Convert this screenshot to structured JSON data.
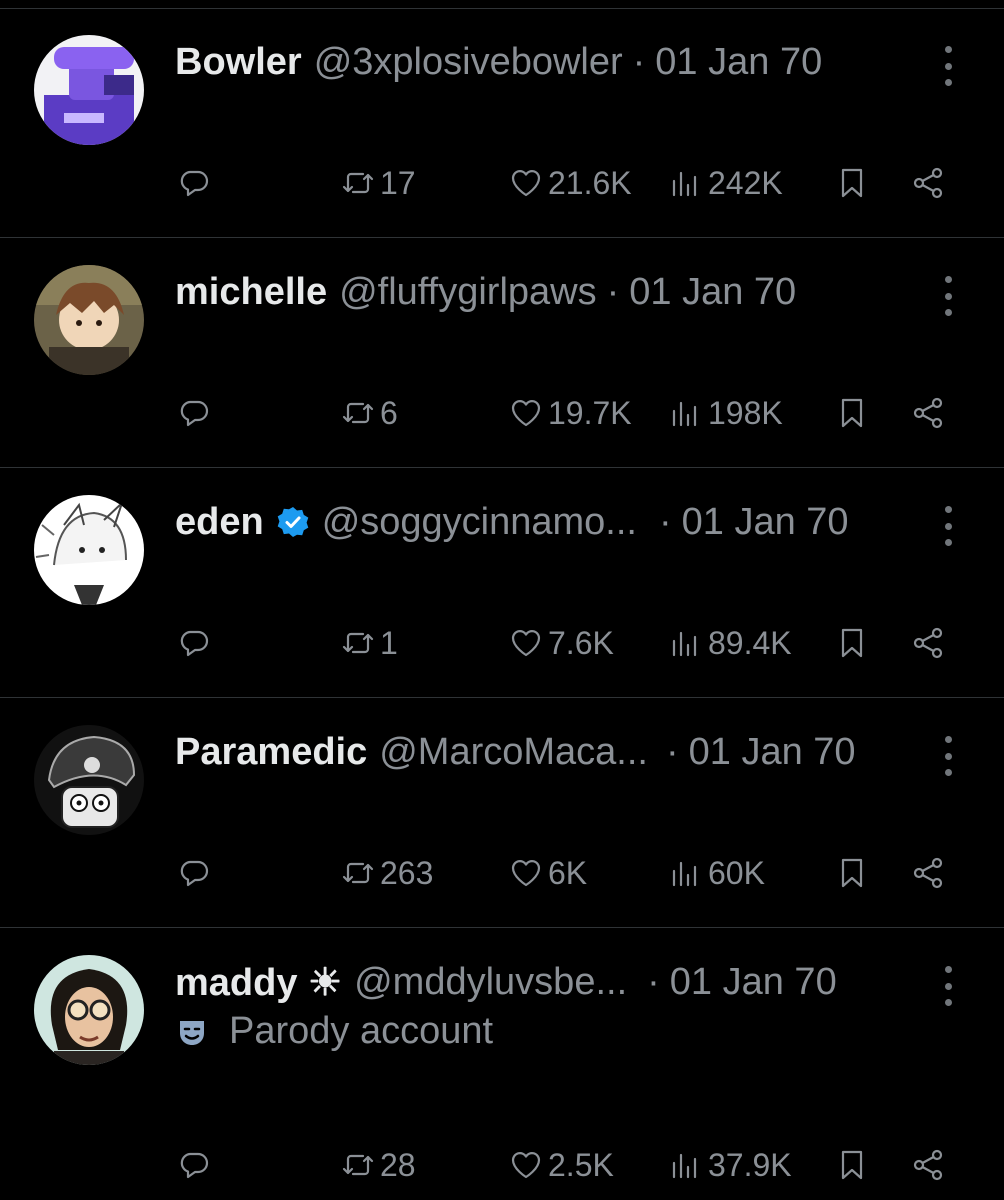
{
  "colors": {
    "background": "#000000",
    "text_primary": "#e7e9ea",
    "text_secondary": "#8b9096",
    "verified_badge": "#1d9bf0",
    "divider": "#2f3336"
  },
  "posts": [
    {
      "name": "Bowler",
      "handle": "@3xplosivebowler",
      "separator": "·",
      "date": "01 Jan 70",
      "verified": false,
      "reposts": "17",
      "likes": "21.6K",
      "views": "242K",
      "avatar": "purple-game-character-avatar"
    },
    {
      "name": "michelle",
      "handle": "@fluffygirlpaws",
      "separator": "·",
      "date": "01 Jan 70",
      "verified": false,
      "reposts": "6",
      "likes": "19.7K",
      "views": "198K",
      "avatar": "anime-boy-avatar"
    },
    {
      "name": "eden",
      "handle": "@soggycinnamo...",
      "separator": "·",
      "date": "01 Jan 70",
      "verified": true,
      "reposts": "1",
      "likes": "7.6K",
      "views": "89.4K",
      "avatar": "white-sketch-character-avatar"
    },
    {
      "name": "Paramedic",
      "handle": "@MarcoMaca...",
      "separator": "·",
      "date": "01 Jan 70",
      "verified": false,
      "reposts": "263",
      "likes": "6K",
      "views": "60K",
      "avatar": "skull-cartoon-avatar"
    },
    {
      "name": "maddy ☀",
      "handle": "@mddyluvsbe...",
      "separator": "·",
      "date": "01 Jan 70",
      "verified": false,
      "label": "Parody account",
      "reposts": "28",
      "likes": "2.5K",
      "views": "37.9K",
      "avatar": "person-round-sunglasses-avatar"
    }
  ]
}
